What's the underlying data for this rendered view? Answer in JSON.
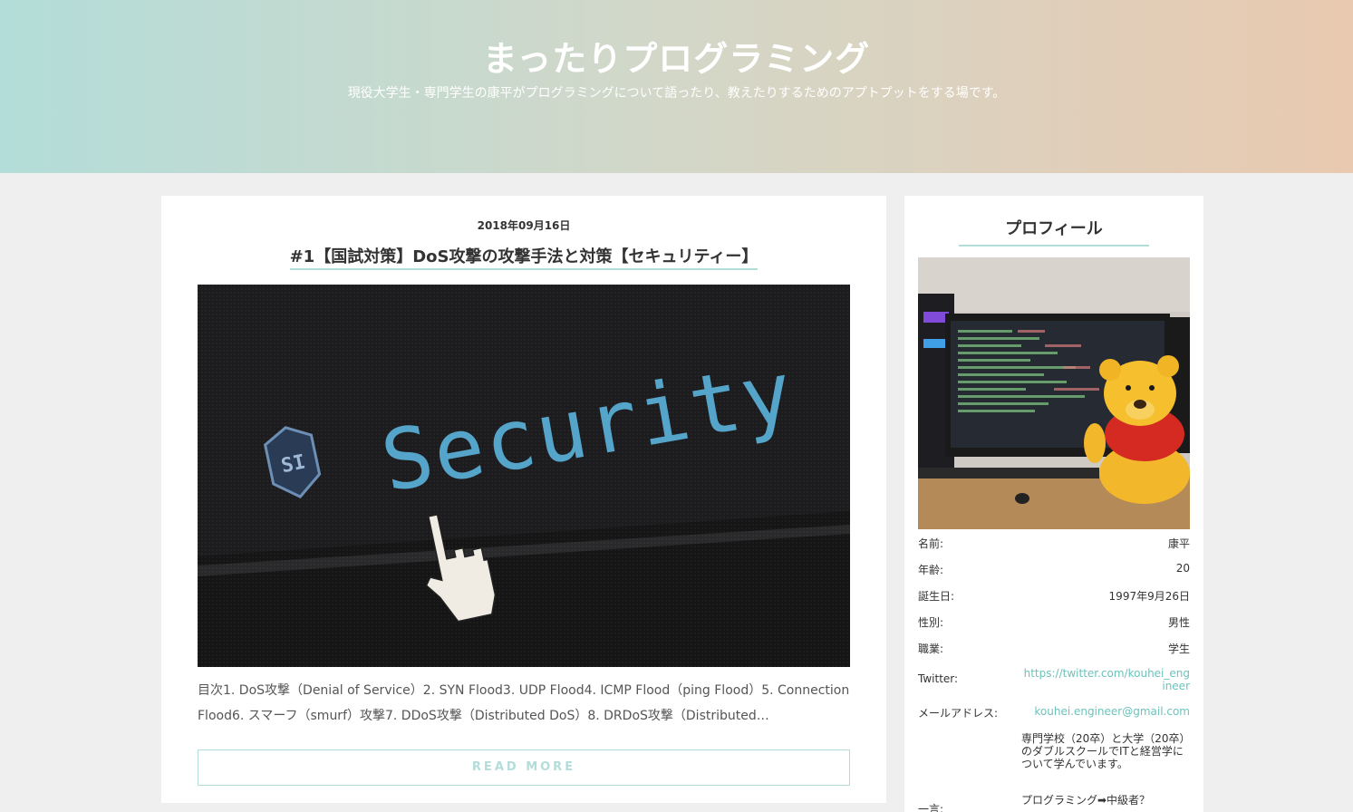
{
  "header": {
    "site_title": "まったりプログラミング",
    "site_description": "現役大学生・専門学生の康平がプログラミングについて語ったり、教えたりするためのアプトプットをする場です。"
  },
  "post": {
    "date": "2018年09月16日",
    "title": "#1【国試対策】DoS攻撃の攻撃手法と対策【セキュリティー】",
    "image_text": "Security",
    "excerpt": "目次1. DoS攻撃（Denial of Service）2. SYN Flood3. UDP Flood4. ICMP Flood（ping Flood）5. Connection Flood6. スマーフ（smurf）攻撃7. DDoS攻撃（Distributed DoS）8. DRDoS攻撃（Distributed…",
    "read_more_label": "READ MORE"
  },
  "sidebar": {
    "title": "プロフィール",
    "rows": [
      {
        "key": "名前:",
        "value": "康平"
      },
      {
        "key": "年齢:",
        "value": "20"
      },
      {
        "key": "誕生日:",
        "value": "1997年9月26日"
      },
      {
        "key": "性別:",
        "value": "男性"
      },
      {
        "key": "職業:",
        "value": "学生"
      },
      {
        "key": "Twitter:",
        "value": "https://twitter.com/kouhei_engineer"
      },
      {
        "key": "メールアドレス:",
        "value": "kouhei.engineer@gmail.com"
      },
      {
        "key": "",
        "value": "専門学校（20卒）と大学（20卒）のダブルスクールでITと経営学について学んでいます。"
      },
      {
        "key": "一言:",
        "value": "プログラミング➡中級者？"
      }
    ]
  },
  "colors": {
    "accent": "#b3ddd9",
    "link": "#6cc3bb",
    "header_left": "#b3ddd9",
    "header_right": "#e9c9b0"
  }
}
